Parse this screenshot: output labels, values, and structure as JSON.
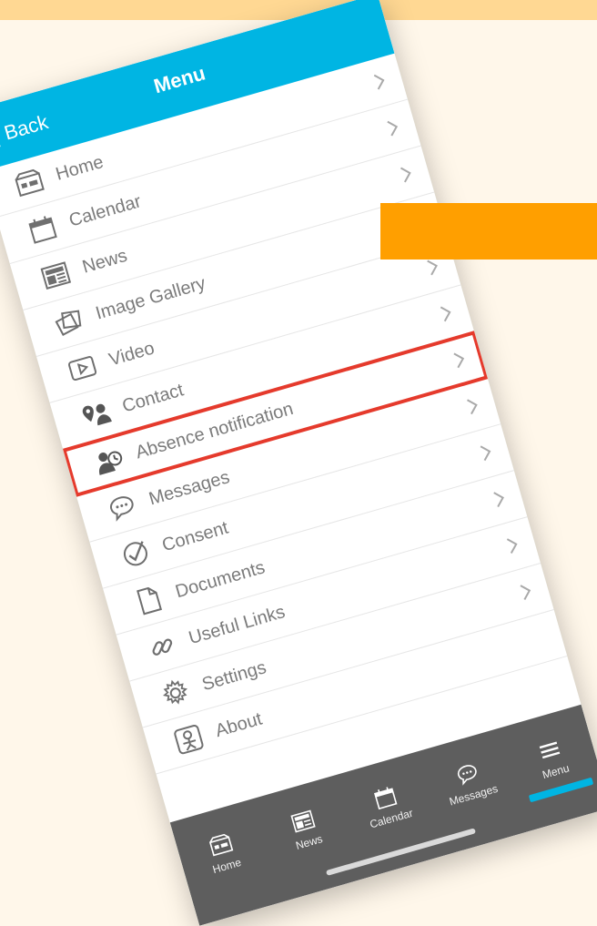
{
  "header": {
    "back_label": "Back",
    "title": "Menu"
  },
  "menu": {
    "items": [
      {
        "label": "Home",
        "icon": "home-icon"
      },
      {
        "label": "Calendar",
        "icon": "calendar-icon"
      },
      {
        "label": "News",
        "icon": "news-icon"
      },
      {
        "label": "Image Gallery",
        "icon": "image-gallery-icon"
      },
      {
        "label": "Video",
        "icon": "video-icon"
      },
      {
        "label": "Contact",
        "icon": "contact-icon"
      },
      {
        "label": "Absence notification",
        "icon": "absence-icon"
      },
      {
        "label": "Messages",
        "icon": "messages-icon"
      },
      {
        "label": "Consent",
        "icon": "consent-icon"
      },
      {
        "label": "Documents",
        "icon": "documents-icon"
      },
      {
        "label": "Useful Links",
        "icon": "link-icon"
      },
      {
        "label": "Settings",
        "icon": "settings-icon"
      },
      {
        "label": "About",
        "icon": "about-icon"
      }
    ]
  },
  "tabbar": {
    "tabs": [
      {
        "label": "Home",
        "icon": "home-icon"
      },
      {
        "label": "News",
        "icon": "news-icon"
      },
      {
        "label": "Calendar",
        "icon": "calendar-icon"
      },
      {
        "label": "Messages",
        "icon": "messages-icon"
      },
      {
        "label": "Menu",
        "icon": "menu-icon"
      }
    ]
  },
  "colors": {
    "header_bg": "#00b5e3",
    "tabbar_bg": "#5e5e5e",
    "highlight": "#e53a2c",
    "accent_orange": "#ff9f00",
    "page_bg": "#fff7ea"
  }
}
